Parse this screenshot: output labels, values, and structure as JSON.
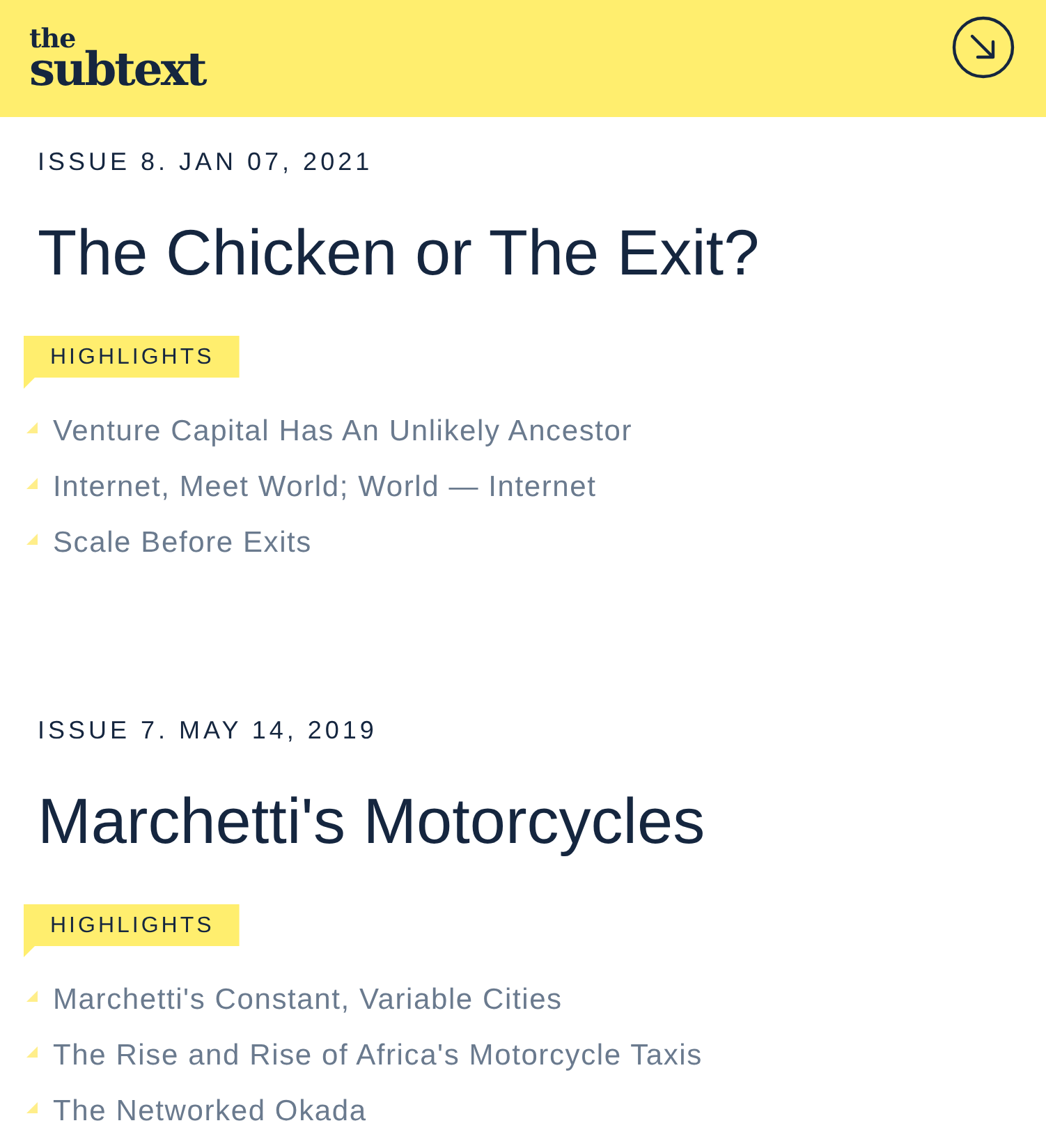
{
  "header": {
    "logo": {
      "small": "the",
      "large": "subtext"
    }
  },
  "issues": [
    {
      "label": "ISSUE 8. JAN 07, 2021",
      "title": "The Chicken or The Exit?",
      "tag": "HIGHLIGHTS",
      "highlights": [
        "Venture Capital Has An Unlikely Ancestor",
        "Internet, Meet World; World — Internet",
        "Scale Before Exits"
      ]
    },
    {
      "label": "ISSUE 7. MAY 14, 2019",
      "title": "Marchetti's Motorcycles",
      "tag": "HIGHLIGHTS",
      "highlights": [
        "Marchetti's Constant, Variable Cities",
        "The Rise and Rise of Africa's Motorcycle Taxis",
        "The Networked Okada"
      ]
    }
  ]
}
